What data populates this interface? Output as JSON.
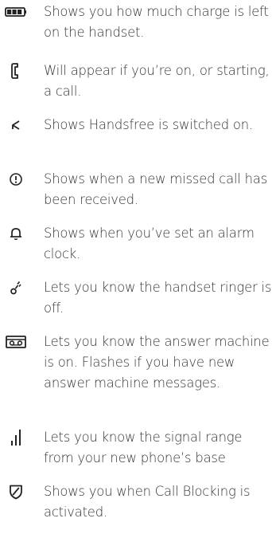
{
  "icon_list": {
    "items": [
      {
        "icon": "battery-icon",
        "text": "Shows you how much charge is left on the handset."
      },
      {
        "icon": "phone-handset-icon",
        "text": "Will appear if you’re on, or starting, a call."
      },
      {
        "icon": "handsfree-speaker-icon",
        "text": "Shows Handsfree is switched on."
      },
      {
        "icon": "missed-call-alert-icon",
        "text": "Shows when a new missed call has been received."
      },
      {
        "icon": "alarm-bell-icon",
        "text": "Shows when you’ve set an alarm clock."
      },
      {
        "icon": "ringer-off-icon",
        "text": "Lets you know the handset ringer is off."
      },
      {
        "icon": "answer-machine-icon",
        "text": "Lets you know the answer machine is on. Flashes if you have new answer machine messages."
      },
      {
        "icon": "signal-strength-icon",
        "text": "Lets you know the signal range from your new phone’s base"
      },
      {
        "icon": "call-blocking-shield-icon",
        "text": "Shows you when Call Blocking is activated."
      }
    ]
  },
  "colors": {
    "text": "#333333",
    "icon": "#222222"
  }
}
